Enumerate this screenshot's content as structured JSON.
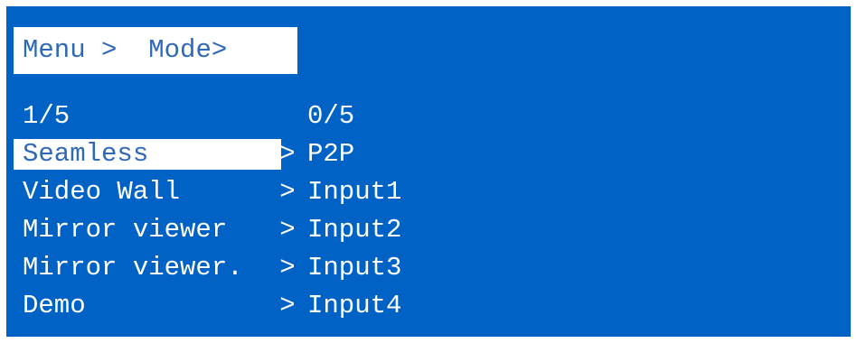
{
  "breadcrumb": {
    "menu": "Menu",
    "sep1": ">",
    "mode": "Mode",
    "sep2": ">"
  },
  "counters": {
    "left": "1/5",
    "right": "0/5"
  },
  "modes": [
    {
      "label": "Seamless",
      "chevron": ">",
      "selected": true
    },
    {
      "label": "Video Wall",
      "chevron": ">",
      "selected": false
    },
    {
      "label": "Mirror viewer",
      "chevron": ">",
      "selected": false
    },
    {
      "label": "Mirror viewer.",
      "chevron": ">",
      "selected": false
    },
    {
      "label": "Demo",
      "chevron": ">",
      "selected": false
    }
  ],
  "options": [
    "P2P",
    "Input1",
    "Input2",
    "Input3",
    "Input4"
  ],
  "colors": {
    "background": "#0062c4",
    "highlight": "#ffffff",
    "highlight_text": "#2e68b9",
    "text": "#ffffff"
  }
}
